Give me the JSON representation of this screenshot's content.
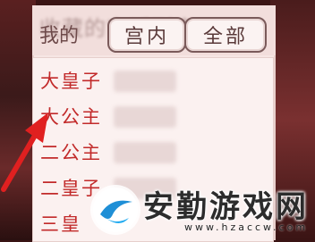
{
  "header": {
    "title": "我的",
    "title_blurred": "收藏的宫廷列表",
    "tabs": [
      {
        "label": "宫内",
        "selected": false
      },
      {
        "label": "全部",
        "selected": true
      }
    ]
  },
  "list": {
    "items": [
      {
        "label": "大皇子"
      },
      {
        "label": "大公主"
      },
      {
        "label": "二公主"
      },
      {
        "label": "二皇子"
      },
      {
        "label": "三皇"
      }
    ]
  },
  "annotation": {
    "arrow_color": "#e02020"
  },
  "watermark": {
    "text": "安勤游戏网",
    "url": "www.hzaccw.com"
  },
  "colors": {
    "accent_red": "#c22a2a",
    "panel_bg": "#f6e6e4"
  }
}
